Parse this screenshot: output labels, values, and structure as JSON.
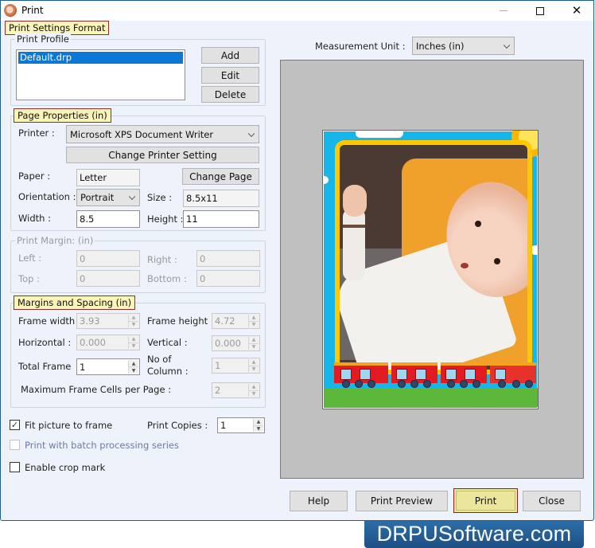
{
  "window": {
    "title": "Print",
    "controls": {
      "minimize": "minimize",
      "maximize": "maximize",
      "close": "close"
    }
  },
  "print_settings": {
    "legend": "Print Settings Format",
    "profile": {
      "title": "Print Profile",
      "items": [
        "Default.drp"
      ],
      "selected": "Default.drp",
      "buttons": {
        "add": "Add",
        "edit": "Edit",
        "delete": "Delete"
      }
    }
  },
  "page_properties": {
    "legend": "Page Properties  (in)",
    "printer_label": "Printer :",
    "printer_value": "Microsoft XPS Document Writer",
    "change_printer_label": "Change Printer Setting",
    "paper_label": "Paper :",
    "paper_value": "Letter",
    "change_page_label": "Change Page",
    "orientation_label": "Orientation :",
    "orientation_value": "Portrait",
    "size_label": "Size :",
    "size_value": "8.5x11",
    "width_label": "Width :",
    "width_value": "8.5",
    "height_label": "Height :",
    "height_value": "11"
  },
  "print_margin": {
    "title": "Print Margin: (in)",
    "left_label": "Left :",
    "left_value": "0",
    "right_label": "Right :",
    "right_value": "0",
    "top_label": "Top :",
    "top_value": "0",
    "bottom_label": "Bottom :",
    "bottom_value": "0"
  },
  "margins_spacing": {
    "legend": "Margins and Spacing  (in)",
    "frame_width_label": "Frame width",
    "frame_width_value": "3.93",
    "frame_height_label": "Frame height :",
    "frame_height_value": "4.72",
    "horizontal_label": "Horizontal :",
    "horizontal_value": "0.000",
    "vertical_label": "Vertical :",
    "vertical_value": "0.000",
    "total_frame_label": "Total Frame",
    "total_frame_value": "1",
    "columns_label_line1": "No of",
    "columns_label_line2": "Column :",
    "columns_value": "1",
    "max_cells_label": "Maximum Frame Cells per Page :",
    "max_cells_value": "2"
  },
  "options": {
    "fit_picture_label": "Fit picture to frame",
    "fit_picture_checked": true,
    "print_copies_label": "Print Copies :",
    "print_copies_value": "1",
    "batch_label": "Print with batch processing series",
    "batch_checked": false,
    "crop_mark_label": "Enable crop mark",
    "crop_mark_checked": false
  },
  "preview": {
    "measurement_label": "Measurement Unit :",
    "measurement_value": "Inches (in)",
    "image_description": "baby photo in cartoon frame with train"
  },
  "footer_buttons": {
    "help": "Help",
    "print_preview": "Print Preview",
    "print": "Print",
    "close": "Close"
  },
  "branding": {
    "text": "DRPUSoftware.com"
  },
  "colors": {
    "accent_legend_bg": "#f9f4b8",
    "accent_legend_border": "#8a2f2f",
    "selection": "#0a78d4",
    "window_border": "#1f5b94",
    "brand_bg": "#1d4f83"
  }
}
